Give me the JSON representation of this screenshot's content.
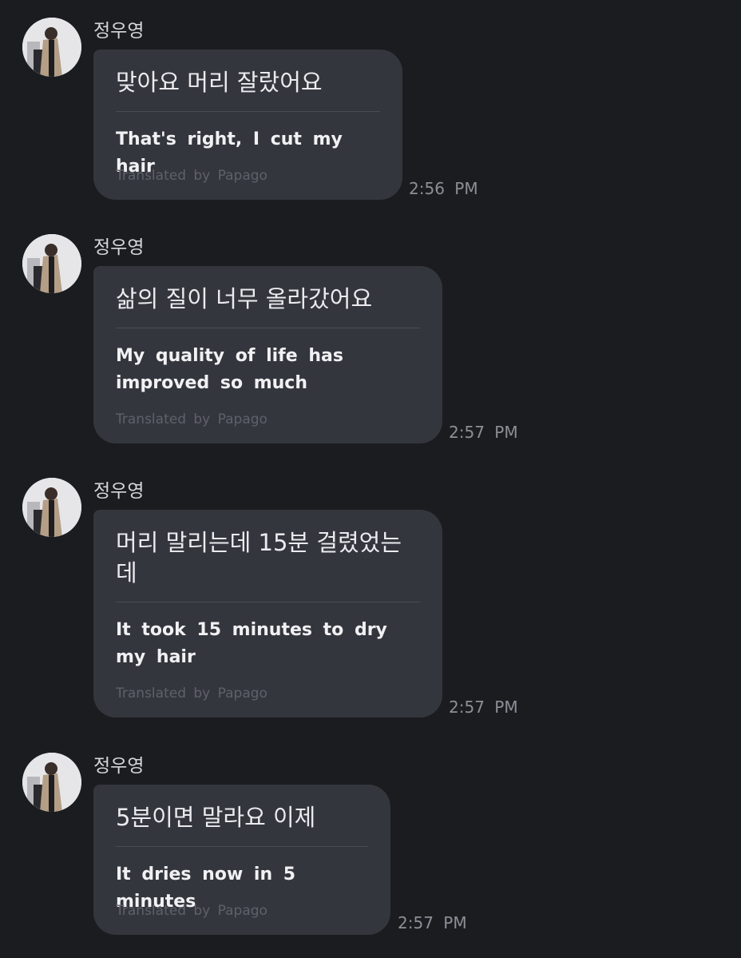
{
  "messages": [
    {
      "sender": "정우영",
      "original": "맞아요 머리 잘랐어요",
      "translation": "That's right, I cut my hair",
      "credit": "Translated by Papago",
      "time": "2:56 PM"
    },
    {
      "sender": "정우영",
      "original": "삶의 질이 너무 올라갔어요",
      "translation": "My quality of life has improved so much",
      "credit": "Translated by Papago",
      "time": "2:57 PM"
    },
    {
      "sender": "정우영",
      "original": "머리 말리는데 15분 걸렸었는데",
      "translation": "It took 15 minutes to dry my hair",
      "credit": "Translated by Papago",
      "time": "2:57 PM"
    },
    {
      "sender": "정우영",
      "original": "5분이면 말라요 이제",
      "translation": "It dries now in 5 minutes",
      "credit": "Translated by Papago",
      "time": "2:57 PM"
    }
  ]
}
